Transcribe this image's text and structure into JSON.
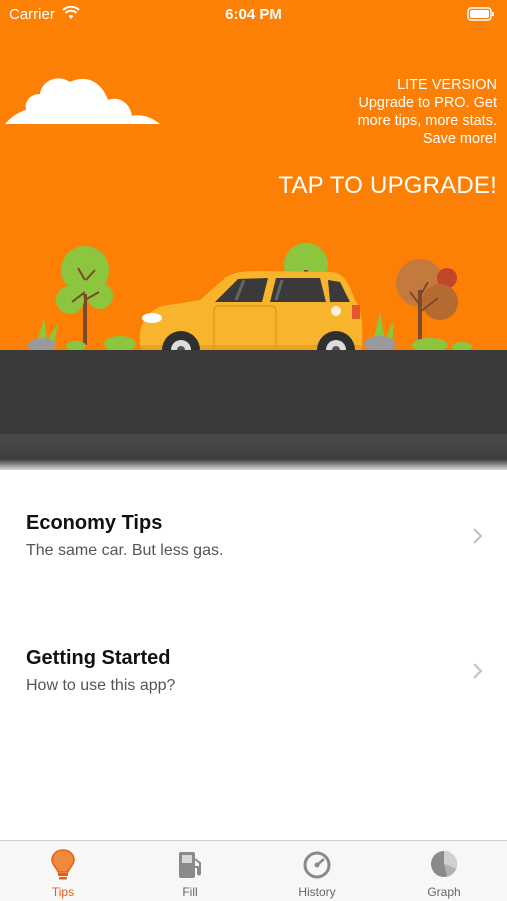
{
  "status": {
    "carrier": "Carrier",
    "time": "6:04 PM"
  },
  "promo": {
    "lines": [
      "LITE VERSION",
      "Upgrade to PRO. Get",
      "more tips, more stats.",
      "Save more!"
    ],
    "cta": "TAP TO UPGRADE!"
  },
  "list": [
    {
      "title": "Economy Tips",
      "subtitle": "The same car. But less gas."
    },
    {
      "title": "Getting Started",
      "subtitle": "How to use this app?"
    }
  ],
  "tabs": [
    {
      "label": "Tips",
      "icon": "lightbulb-icon",
      "active": true
    },
    {
      "label": "Fill",
      "icon": "fuel-pump-icon"
    },
    {
      "label": "History",
      "icon": "history-icon"
    },
    {
      "label": "Graph",
      "icon": "pie-chart-icon"
    }
  ],
  "colors": {
    "accent": "#fc7f06",
    "active_tab": "#e85d16",
    "road": "#3a3a3a",
    "car": "#f9b42d"
  }
}
